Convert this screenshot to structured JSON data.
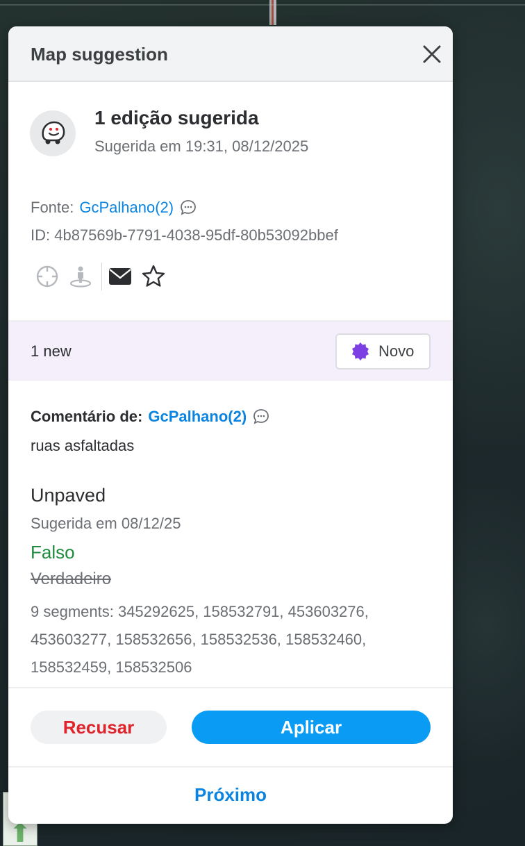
{
  "panel": {
    "title": "Map suggestion",
    "close_icon": "close-icon"
  },
  "summary": {
    "avatar_icon": "waze-icon",
    "title": "1 edição sugerida",
    "subtitle": "Sugerida em 19:31, 08/12/2025",
    "source_label": "Fonte:",
    "source_user": "GcPalhano(2)",
    "id_text": "ID: 4b87569b-7791-4038-95df-80b53092bbef",
    "actions": [
      "crosshair-icon",
      "street-view-icon",
      "envelope-icon",
      "star-icon"
    ]
  },
  "new_bar": {
    "count_text": "1 new",
    "badge_label": "Novo",
    "badge_color": "#7b3fe4"
  },
  "detail": {
    "comment_label": "Comentário de:",
    "comment_user": "GcPalhano(2)",
    "comment_text": "ruas asfaltadas",
    "attribute_name": "Unpaved",
    "attribute_date": "Sugerida em 08/12/25",
    "new_value": "Falso",
    "old_value": "Verdadeiro",
    "segments_text": "9 segments: 345292625, 158532791, 453603276, 453603277, 158532656, 158532536, 158532460, 158532459, 158532506"
  },
  "buttons": {
    "reject_label": "Recusar",
    "apply_label": "Aplicar",
    "next_label": "Próximo"
  },
  "colors": {
    "accent": "#0a9cf5",
    "link": "#0a84e0",
    "reject": "#e0242b",
    "new_value": "#1e8a3e"
  }
}
